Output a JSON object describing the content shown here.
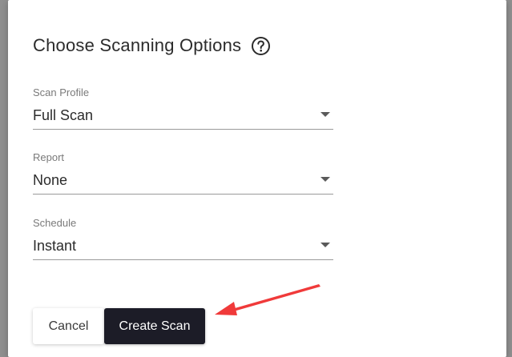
{
  "dialog": {
    "title": "Choose Scanning Options",
    "help_icon": "question-circle-icon"
  },
  "fields": {
    "scan_profile": {
      "label": "Scan Profile",
      "value": "Full Scan"
    },
    "report": {
      "label": "Report",
      "value": "None"
    },
    "schedule": {
      "label": "Schedule",
      "value": "Instant"
    }
  },
  "actions": {
    "cancel_label": "Cancel",
    "create_label": "Create Scan"
  },
  "colors": {
    "primary_button": "#1c1c27",
    "annotation_arrow": "#f03a3a"
  }
}
